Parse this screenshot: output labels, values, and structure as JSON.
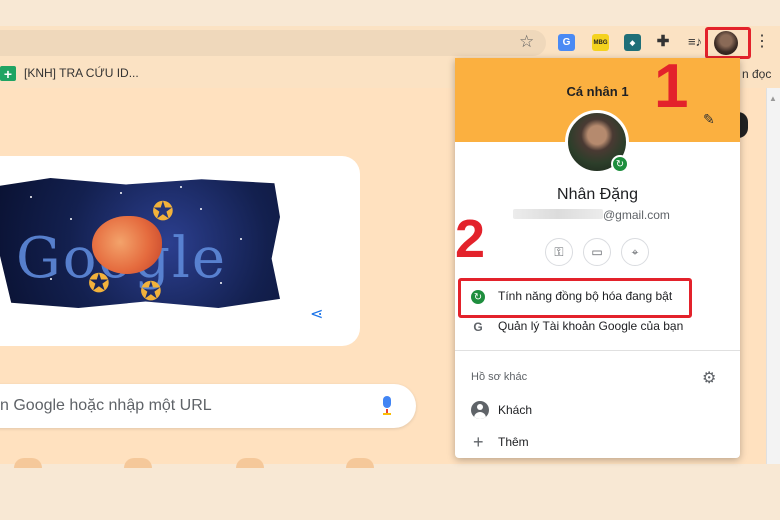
{
  "toolbar": {
    "extensions": [
      "translate-extension",
      "mbg-extension",
      "dark-extension",
      "extensions-puzzle",
      "media-control"
    ],
    "ext_mbg_text": "MBG"
  },
  "bookmarks": {
    "item1": "[KNH] TRA CỨU ID...",
    "right_partial": "n đọc"
  },
  "newtab": {
    "doodle_text": "Google",
    "search_placeholder": "n Google hoặc nhập một URL"
  },
  "profile_menu": {
    "title": "Cá nhân 1",
    "name": "Nhân Đặng",
    "email": "@gmail.com",
    "sync_label": "Tính năng đồng bộ hóa đang bật",
    "manage_label": "Quản lý Tài khoản Google của bạn",
    "other_profiles_label": "Hồ sơ khác",
    "guest_label": "Khách",
    "add_label": "Thêm"
  },
  "annotations": {
    "marker_1": "1",
    "marker_2": "2"
  },
  "colors": {
    "profile_header": "#fbb040",
    "sync_green": "#1e8e3e",
    "highlight_red": "#e3222b",
    "page_bg": "#ffe1bf"
  }
}
